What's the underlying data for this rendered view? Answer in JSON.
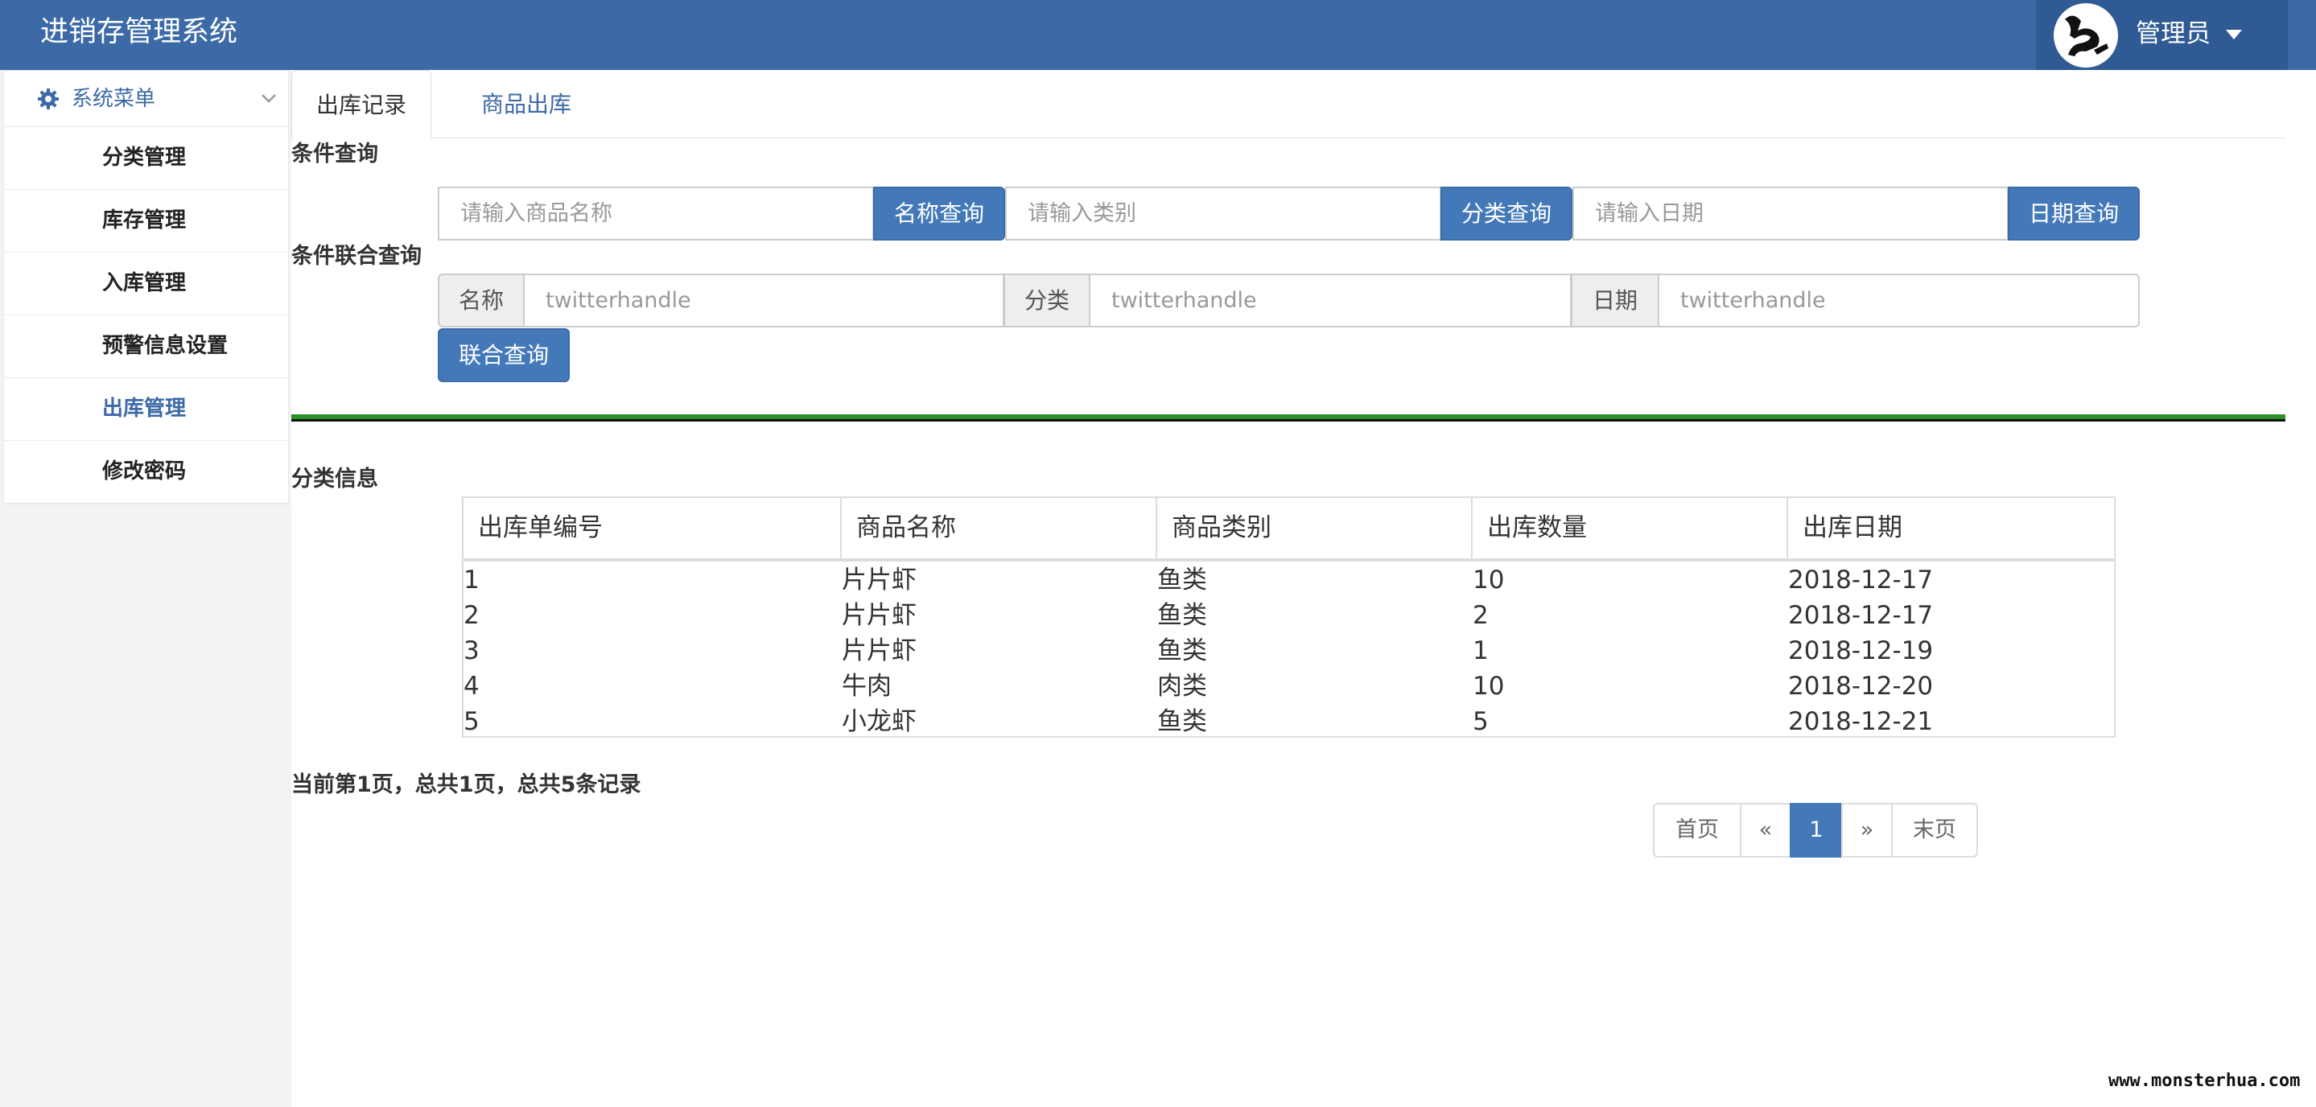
{
  "header": {
    "title": "进销存管理系统",
    "user": "管理员"
  },
  "sidebar": {
    "head": "系统菜单",
    "items": [
      {
        "label": "分类管理"
      },
      {
        "label": "库存管理"
      },
      {
        "label": "入库管理"
      },
      {
        "label": "预警信息设置"
      },
      {
        "label": "出库管理"
      },
      {
        "label": "修改密码"
      }
    ]
  },
  "tabs": [
    {
      "label": "出库记录"
    },
    {
      "label": "商品出库"
    }
  ],
  "query": {
    "section_label": "条件查询",
    "name_placeholder": "请输入商品名称",
    "name_button": "名称查询",
    "category_placeholder": "请输入类别",
    "category_button": "分类查询",
    "date_placeholder": "请输入日期",
    "date_button": "日期查询"
  },
  "union": {
    "section_label": "条件联合查询",
    "name_addon": "名称",
    "name_placeholder": "twitterhandle",
    "category_addon": "分类",
    "category_placeholder": "twitterhandle",
    "date_addon": "日期",
    "date_placeholder": "twitterhandle",
    "button": "联合查询"
  },
  "table": {
    "section_label": "分类信息",
    "headers": [
      "出库单编号",
      "商品名称",
      "商品类别",
      "出库数量",
      "出库日期"
    ],
    "rows": [
      [
        "1",
        "片片虾",
        "鱼类",
        "10",
        "2018-12-17"
      ],
      [
        "2",
        "片片虾",
        "鱼类",
        "2",
        "2018-12-17"
      ],
      [
        "3",
        "片片虾",
        "鱼类",
        "1",
        "2018-12-19"
      ],
      [
        "4",
        "牛肉",
        "肉类",
        "10",
        "2018-12-20"
      ],
      [
        "5",
        "小龙虾",
        "鱼类",
        "5",
        "2018-12-21"
      ]
    ]
  },
  "pagination": {
    "info": "当前第1页，总共1页，总共5条记录",
    "first": "首页",
    "prev": "«",
    "current": "1",
    "next": "»",
    "last": "末页"
  },
  "watermark": "www.monsterhua.com",
  "colors": {
    "header": "#3c6aa7",
    "primary": "#4479b9",
    "divider": "#2f8f2a"
  }
}
